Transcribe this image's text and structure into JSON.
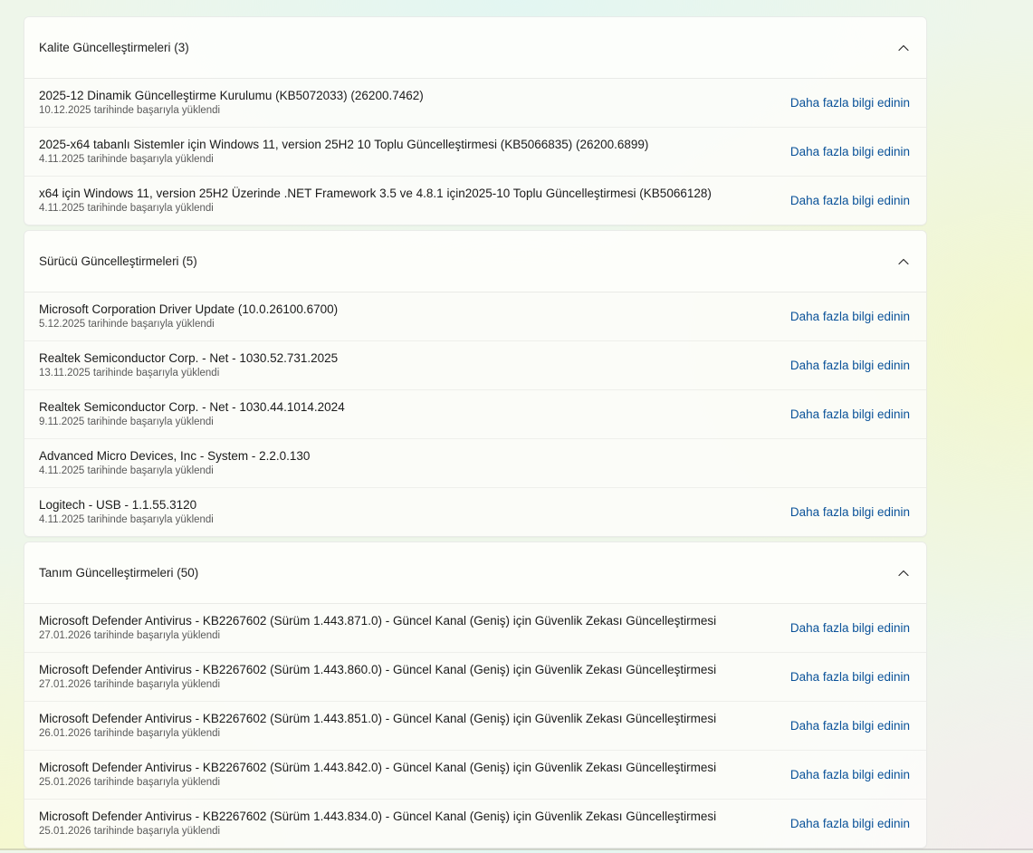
{
  "sections": [
    {
      "title": "Kalite Güncelleştirmeleri (3)",
      "rows": [
        {
          "title": "2025-12 Dinamik Güncelleştirme Kurulumu (KB5072033) (26200.7462)",
          "subtitle": "10.12.2025 tarihinde başarıyla yüklendi",
          "link": "Daha fazla bilgi edinin"
        },
        {
          "title": "2025-x64 tabanlı Sistemler için Windows 11, version 25H2 10 Toplu Güncelleştirmesi (KB5066835) (26200.6899)",
          "subtitle": "4.11.2025 tarihinde başarıyla yüklendi",
          "link": "Daha fazla bilgi edinin"
        },
        {
          "title": "x64 için Windows 11, version 25H2 Üzerinde .NET Framework 3.5 ve 4.8.1 için2025-10 Toplu Güncelleştirmesi (KB5066128)",
          "subtitle": "4.11.2025 tarihinde başarıyla yüklendi",
          "link": "Daha fazla bilgi edinin"
        }
      ]
    },
    {
      "title": "Sürücü Güncelleştirmeleri (5)",
      "rows": [
        {
          "title": "Microsoft Corporation Driver Update (10.0.26100.6700)",
          "subtitle": "5.12.2025 tarihinde başarıyla yüklendi",
          "link": "Daha fazla bilgi edinin"
        },
        {
          "title": "Realtek Semiconductor Corp. - Net - 1030.52.731.2025",
          "subtitle": "13.11.2025 tarihinde başarıyla yüklendi",
          "link": "Daha fazla bilgi edinin"
        },
        {
          "title": "Realtek Semiconductor Corp. - Net - 1030.44.1014.2024",
          "subtitle": "9.11.2025 tarihinde başarıyla yüklendi",
          "link": "Daha fazla bilgi edinin"
        },
        {
          "title": "Advanced Micro Devices, Inc - System - 2.2.0.130",
          "subtitle": "4.11.2025 tarihinde başarıyla yüklendi",
          "link": ""
        },
        {
          "title": "Logitech - USB - 1.1.55.3120",
          "subtitle": "4.11.2025 tarihinde başarıyla yüklendi",
          "link": "Daha fazla bilgi edinin"
        }
      ]
    },
    {
      "title": "Tanım Güncelleştirmeleri (50)",
      "rows": [
        {
          "title": "Microsoft Defender Antivirus - KB2267602 (Sürüm 1.443.871.0) - Güncel Kanal (Geniş) için Güvenlik Zekası Güncelleştirmesi",
          "subtitle": "27.01.2026 tarihinde başarıyla yüklendi",
          "link": "Daha fazla bilgi edinin"
        },
        {
          "title": "Microsoft Defender Antivirus - KB2267602 (Sürüm 1.443.860.0) - Güncel Kanal (Geniş) için Güvenlik Zekası Güncelleştirmesi",
          "subtitle": "27.01.2026 tarihinde başarıyla yüklendi",
          "link": "Daha fazla bilgi edinin"
        },
        {
          "title": "Microsoft Defender Antivirus - KB2267602 (Sürüm 1.443.851.0) - Güncel Kanal (Geniş) için Güvenlik Zekası Güncelleştirmesi",
          "subtitle": "26.01.2026 tarihinde başarıyla yüklendi",
          "link": "Daha fazla bilgi edinin"
        },
        {
          "title": "Microsoft Defender Antivirus - KB2267602 (Sürüm 1.443.842.0) - Güncel Kanal (Geniş) için Güvenlik Zekası Güncelleştirmesi",
          "subtitle": "25.01.2026 tarihinde başarıyla yüklendi",
          "link": "Daha fazla bilgi edinin"
        },
        {
          "title": "Microsoft Defender Antivirus - KB2267602 (Sürüm 1.443.834.0) - Güncel Kanal (Geniş) için Güvenlik Zekası Güncelleştirmesi",
          "subtitle": "25.01.2026 tarihinde başarıyla yüklendi",
          "link": "Daha fazla bilgi edinin"
        }
      ]
    }
  ],
  "icons": {
    "collapse": "chevron-up-icon"
  },
  "colors": {
    "link": "#0a5299",
    "text": "#1b1b1b",
    "subtext": "#5a5a5a"
  }
}
